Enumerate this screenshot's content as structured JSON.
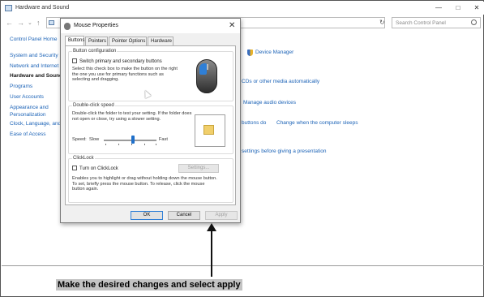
{
  "window": {
    "title": "Hardware and Sound",
    "minimize_icon": "minimize-icon",
    "maximize_icon": "maximize-icon",
    "close_icon": "close-icon"
  },
  "nav": {
    "back_icon": "arrow-left-icon",
    "forward_icon": "arrow-right-icon",
    "up_icon": "arrow-up-icon",
    "search_placeholder": "Search Control Panel"
  },
  "sidebar": {
    "items": [
      {
        "label": "Control Panel Home",
        "current": false
      },
      {
        "label": "System and Security",
        "current": false
      },
      {
        "label": "Network and Internet",
        "current": false
      },
      {
        "label": "Hardware and Sound",
        "current": true
      },
      {
        "label": "Programs",
        "current": false
      },
      {
        "label": "User Accounts",
        "current": false
      },
      {
        "label": "Appearance and",
        "current": false
      },
      {
        "label": "Personalization",
        "current": false
      },
      {
        "label": "Clock, Language, and",
        "current": false
      },
      {
        "label": "Ease of Access",
        "current": false
      }
    ]
  },
  "content": {
    "device_manager": "Device Manager",
    "cds_media": "CDs or other media automatically",
    "manage_audio": "Manage audio devices",
    "buttons_do": "buttons do",
    "computer_sleeps": "Change when the computer sleeps",
    "presentation": "settings before giving a presentation"
  },
  "dialog": {
    "title": "Mouse Properties",
    "tabs": [
      "Buttons",
      "Pointers",
      "Pointer Options",
      "Hardware"
    ],
    "active_tab": "Buttons",
    "button_config": {
      "label": "Button configuration",
      "checkbox_label": "Switch primary and secondary buttons",
      "checked": false,
      "description": "Select this check box to make the button on the right the one you use for primary functions such as selecting and dragging."
    },
    "double_click": {
      "label": "Double-click speed",
      "description": "Double-click the folder to test your setting. If the folder does not open or close, try using a slower setting.",
      "speed_label": "Speed:",
      "slow_label": "Slow",
      "fast_label": "Fast",
      "speed_level_fraction": 0.55
    },
    "clicklock": {
      "label": "ClickLock",
      "checkbox_label": "Turn on ClickLock",
      "checked": false,
      "settings_label": "Settings...",
      "description": "Enables you to highlight or drag without holding down the mouse button. To set, briefly press the mouse button. To release, click the mouse button again."
    },
    "ok_label": "OK",
    "cancel_label": "Cancel",
    "apply_label": "Apply"
  },
  "caption": "Make the desired changes and select apply"
}
